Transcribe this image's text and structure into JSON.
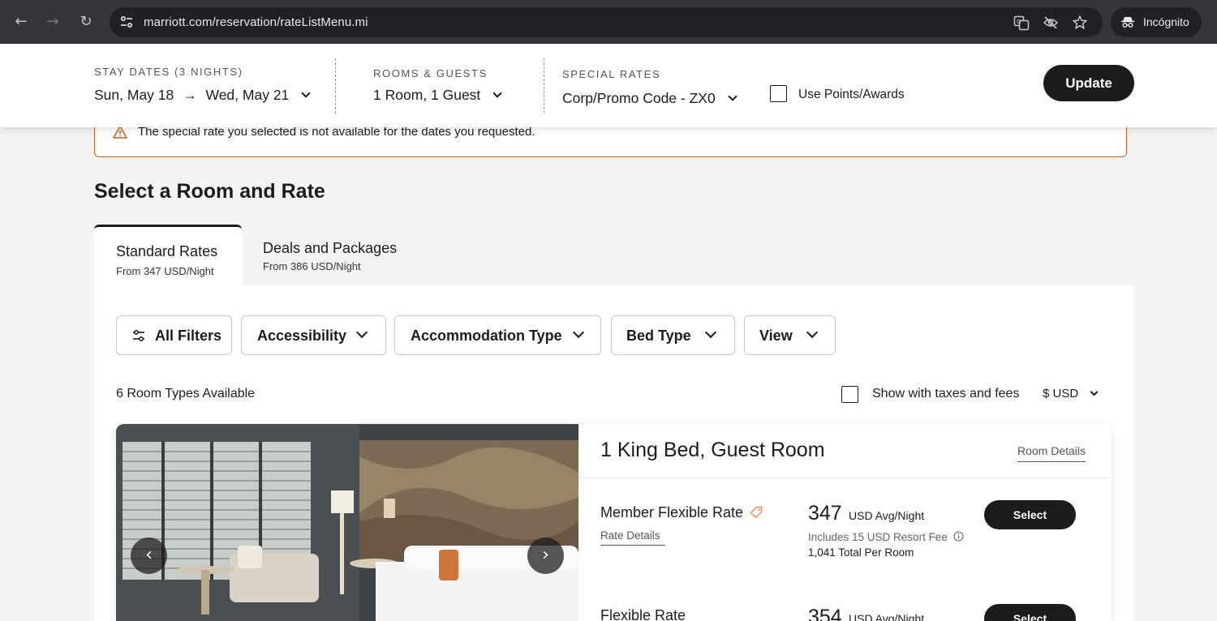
{
  "browser": {
    "url": "marriott.com/reservation/rateListMenu.mi",
    "profile_label": "Incógnito"
  },
  "search": {
    "stay_label": "STAY DATES (3 NIGHTS)",
    "check_in": "Sun, May 18",
    "arrow": "→",
    "check_out": "Wed, May 21",
    "rooms_label": "ROOMS & GUESTS",
    "rooms_value": "1 Room, 1 Guest",
    "special_label": "SPECIAL RATES",
    "special_value": "Corp/Promo Code - ZX0",
    "points_label": "Use Points/Awards",
    "update_label": "Update"
  },
  "alert": {
    "message": "The special rate you selected is not available for the dates you requested."
  },
  "page": {
    "heading": "Select a Room and Rate"
  },
  "tabs": [
    {
      "title": "Standard Rates",
      "subtitle": "From 347 USD/Night",
      "active": true
    },
    {
      "title": "Deals and Packages",
      "subtitle": "From 386 USD/Night",
      "active": false
    }
  ],
  "filters": {
    "all_filters": "All Filters",
    "accessibility": "Accessibility",
    "accommodation_type": "Accommodation Type",
    "bed_type": "Bed Type",
    "view": "View"
  },
  "results": {
    "count_label": "6 Room Types Available",
    "taxes_label": "Show with taxes and fees",
    "currency": "$ USD"
  },
  "room": {
    "title": "1 King Bed, Guest Room",
    "details_link": "Room Details",
    "rates": [
      {
        "name": "Member Flexible Rate",
        "details_link": "Rate Details",
        "price": "347",
        "unit": "USD Avg/Night",
        "fee": "Includes 15 USD Resort Fee",
        "total": "1,041 Total Per Room",
        "select_label": "Select"
      },
      {
        "name": "Flexible Rate",
        "price": "354",
        "unit": "USD Avg/Night",
        "select_label": "Select"
      }
    ]
  },
  "colors": {
    "brand_dark": "#1c1c1c",
    "alert_border": "#c4621c",
    "page_bg": "#f4f4f4"
  }
}
